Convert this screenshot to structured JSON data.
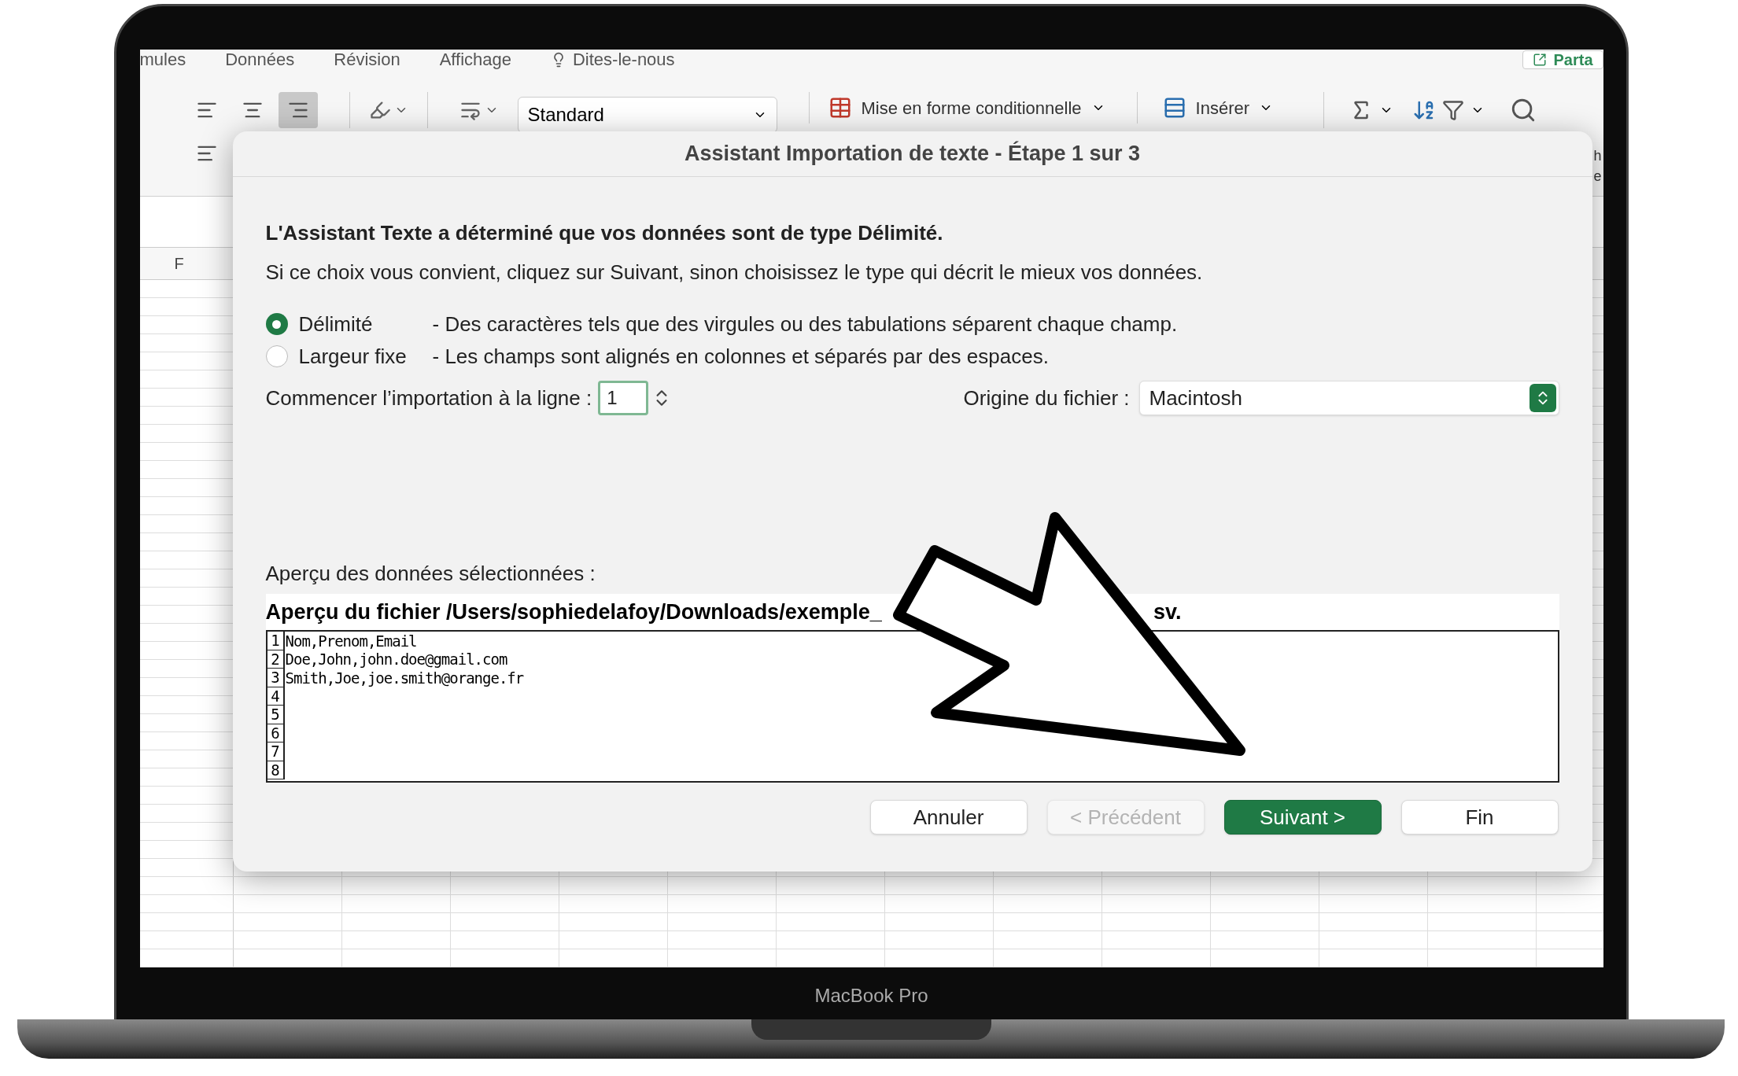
{
  "device": {
    "label": "MacBook Pro"
  },
  "ribbon": {
    "tabs": [
      {
        "label": "mules"
      },
      {
        "label": "Données"
      },
      {
        "label": "Révision"
      },
      {
        "label": "Affichage"
      },
      {
        "label": "Dites-le-nous"
      }
    ],
    "share_button": "Parta",
    "alignment": [
      {
        "selected": false
      },
      {
        "selected": false
      },
      {
        "selected": true
      }
    ],
    "number_format": "Standard",
    "buttons": [
      {
        "label": "Mise en forme conditionnelle"
      },
      {
        "label": "Insérer"
      }
    ],
    "cut_letters": [
      "h",
      "e"
    ]
  },
  "sheet": {
    "column_header": "F"
  },
  "dialog": {
    "title": "Assistant Importation de texte - Étape 1 sur 3",
    "heading": "L'Assistant Texte a déterminé que vos données sont de type Délimité.",
    "intro": "Si ce choix vous convient, cliquez sur Suivant, sinon choisissez le type qui décrit le mieux vos données.",
    "options": [
      {
        "label": "Délimité",
        "description": "- Des caractères tels que des virgules ou des tabulations séparent chaque champ.",
        "selected": true
      },
      {
        "label": "Largeur fixe",
        "description": "- Les champs sont alignés en colonnes et séparés par des espaces.",
        "selected": false
      }
    ],
    "start_row": {
      "label": "Commencer l’importation à la ligne :",
      "value": "1"
    },
    "file_origin": {
      "label": "Origine du fichier :",
      "value": "Macintosh"
    },
    "preview_label": "Aperçu des données sélectionnées :",
    "preview": {
      "header_parts": [
        "Aperçu du fichier /Users/sophiedelafoy/Downloads/exemple_",
        "sv."
      ],
      "rows": [
        {
          "number": "1",
          "text": "Nom,Prenom,Email"
        },
        {
          "number": "2",
          "text": "Doe,John,john.doe@gmail.com"
        },
        {
          "number": "3",
          "text": "Smith,Joe,joe.smith@orange.fr"
        },
        {
          "number": "4",
          "text": ""
        },
        {
          "number": "5",
          "text": ""
        },
        {
          "number": "6",
          "text": ""
        },
        {
          "number": "7",
          "text": ""
        },
        {
          "number": "8",
          "text": ""
        }
      ]
    },
    "buttons": [
      {
        "label": "Annuler",
        "kind": "default",
        "disabled": false
      },
      {
        "label": "< Précédent",
        "kind": "default",
        "disabled": true
      },
      {
        "label": "Suivant >",
        "kind": "primary",
        "disabled": false
      },
      {
        "label": "Fin",
        "kind": "default",
        "disabled": false
      }
    ]
  }
}
